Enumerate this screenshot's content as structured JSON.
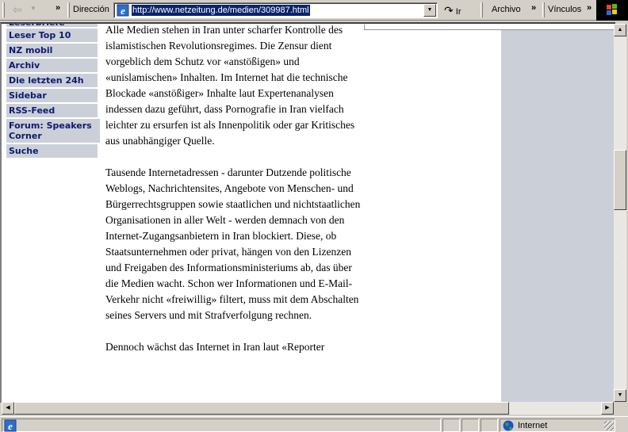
{
  "toolbar": {
    "back_icon": "back-arrow-icon",
    "address_label": "Dirección",
    "url": "http://www.netzeitung.de/medien/309987.html",
    "go_label": "Ir",
    "menu_archivo": "Archivo",
    "links_label": "Vínculos",
    "chevron": "»",
    "back_glyph": "⇦",
    "dropdown_glyph": "▼",
    "go_glyph": "↷"
  },
  "sidebar": {
    "items": [
      {
        "label": "Leserbriefe"
      },
      {
        "label": "Leser Top 10"
      },
      {
        "label": "NZ mobil"
      },
      {
        "label": "Archiv"
      },
      {
        "label": "Die letzten 24h"
      },
      {
        "label": "Sidebar"
      },
      {
        "label": "RSS-Feed"
      },
      {
        "label": "Forum: Speakers Corner"
      },
      {
        "label": "Suche"
      }
    ]
  },
  "article": {
    "paragraphs": [
      "Alle Medien stehen in Iran unter scharfer Kontrolle des islamistischen Revolutionsregimes. Die Zensur dient vorgeblich dem Schutz vor «anstößigen» und «unislamischen» Inhalten. Im Internet hat die technische Blockade «anstößiger» Inhalte laut Expertenanalysen indessen dazu geführt, dass Pornografie in Iran vielfach leichter zu ersurfen ist als Innenpolitik oder gar Kritisches aus unabhängiger Quelle.",
      "Tausende Internetadressen - darunter Dutzende politische Weblogs, Nachrichtensites, Angebote von Menschen- und Bürgerrechtsgruppen sowie staatlichen und nichtstaatlichen Organisationen in aller Welt - werden demnach von den Internet-Zugangsanbietern in Iran blockiert. Diese, ob Staatsunternehmen oder privat, hängen von den Lizenzen und Freigaben des Informationsministeriums ab, das über die Medien wacht. Schon wer Informationen und E-Mail-Verkehr nicht «freiwillig» filtert, muss mit dem Abschalten seines Servers und mit Strafverfolgung rechnen.",
      "Dennoch wächst das Internet in Iran laut «Reporter"
    ]
  },
  "scrollbars": {
    "up_glyph": "▲",
    "down_glyph": "▼",
    "left_glyph": "◀",
    "right_glyph": "▶"
  },
  "statusbar": {
    "zone": "Internet"
  }
}
